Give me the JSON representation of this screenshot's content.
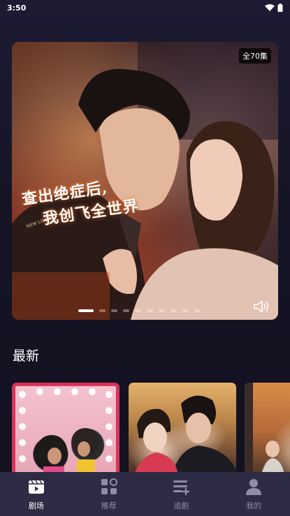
{
  "status_bar": {
    "time": "3:50"
  },
  "hero": {
    "episode_badge": "全70集",
    "title_line1": "查出绝症后,",
    "title_line2": "我创飞全世界",
    "tag": "NEW LIFE",
    "carousel_count": 10,
    "carousel_active_index": 0
  },
  "section": {
    "title": "最新"
  },
  "bottom_nav": {
    "items": [
      {
        "label": "剧场",
        "icon": "theater-icon",
        "active": true
      },
      {
        "label": "推荐",
        "icon": "grid-icon",
        "active": false
      },
      {
        "label": "追剧",
        "icon": "playlist-add-icon",
        "active": false
      },
      {
        "label": "我的",
        "icon": "person-icon",
        "active": false
      }
    ]
  },
  "colors": {
    "background": "#151424",
    "nav_background": "#2e2c44",
    "nav_inactive": "#8f8ca5",
    "nav_active": "#ffffff"
  }
}
